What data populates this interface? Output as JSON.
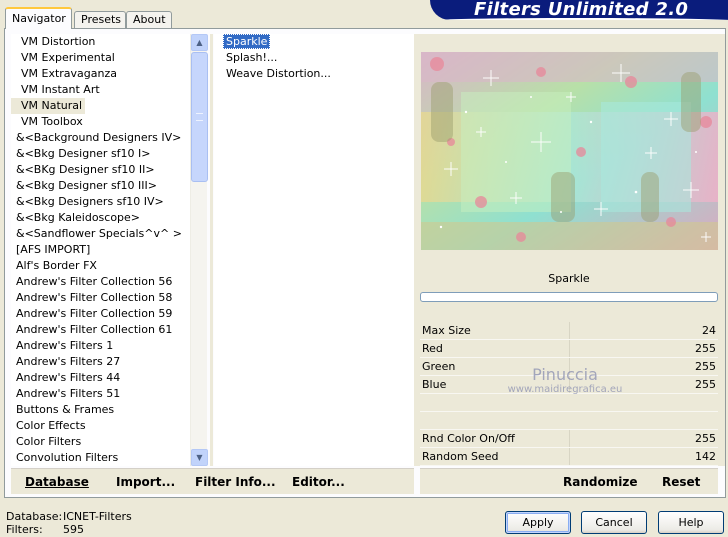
{
  "title": "Filters Unlimited 2.0",
  "tabs": [
    "Navigator",
    "Presets",
    "About"
  ],
  "categories": [
    "VM Distortion",
    "VM Experimental",
    "VM Extravaganza",
    "VM Instant Art",
    "VM Natural",
    "VM Toolbox",
    "&<Background Designers IV>",
    "&<Bkg Designer sf10 I>",
    "&<BKg Designer sf10 II>",
    "&<Bkg Designer sf10 III>",
    "&<Bkg Designers sf10 IV>",
    "&<Bkg Kaleidoscope>",
    "&<Sandflower Specials^v^ >",
    "[AFS IMPORT]",
    "Alf's Border FX",
    "Andrew's Filter Collection 56",
    "Andrew's Filter Collection 58",
    "Andrew's Filter Collection 59",
    "Andrew's Filter Collection 61",
    "Andrew's Filters 1",
    "Andrew's Filters 27",
    "Andrew's Filters 44",
    "Andrew's Filters 51",
    "Buttons & Frames",
    "Color Effects",
    "Color Filters",
    "Convolution Filters"
  ],
  "selected_category": "VM Natural",
  "filters": [
    "Sparkle",
    "Splash!...",
    "Weave Distortion..."
  ],
  "selected_filter": "Sparkle",
  "filter_name": "Sparkle",
  "params": [
    {
      "label": "Max Size",
      "value": "24"
    },
    {
      "label": "Red",
      "value": "255"
    },
    {
      "label": "Green",
      "value": "255"
    },
    {
      "label": "Blue",
      "value": "255"
    },
    {
      "label": "",
      "value": ""
    },
    {
      "label": "",
      "value": ""
    },
    {
      "label": "Rnd Color On/Off",
      "value": "255"
    },
    {
      "label": "Random Seed",
      "value": "142"
    }
  ],
  "watermark": {
    "line1": "Pinuccia",
    "line2": "www.maidiregrafica.eu"
  },
  "left_buttons": {
    "database": "Database",
    "import": "Import...",
    "filter_info": "Filter Info...",
    "editor": "Editor..."
  },
  "right_buttons": {
    "randomize": "Randomize",
    "reset": "Reset"
  },
  "status": {
    "database_label": "Database:",
    "database_value": "ICNET-Filters",
    "filters_label": "Filters:",
    "filters_value": "595"
  },
  "dialog_buttons": {
    "apply": "Apply",
    "cancel": "Cancel",
    "help": "Help"
  },
  "colors": {
    "banner": "#0a1c7c",
    "selection": "#316ac5",
    "background": "#ece9d8"
  }
}
